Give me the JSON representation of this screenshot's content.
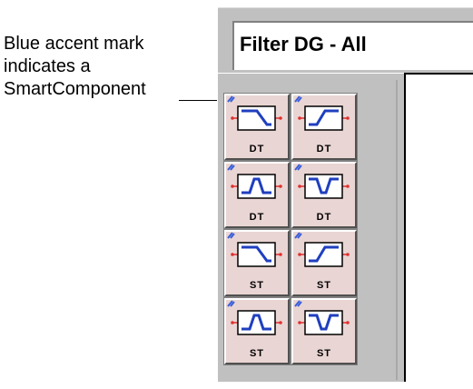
{
  "callout": {
    "lines": [
      "Blue accent mark",
      "indicates a",
      "SmartComponent"
    ]
  },
  "palette": {
    "filter_title": "Filter DG - All",
    "accent_color": "#3b5fd9",
    "pin_color": "#e03030",
    "components": [
      {
        "shape": "lowpass",
        "label": "DT",
        "icon": "lowpass-filter-icon"
      },
      {
        "shape": "highpass",
        "label": "DT",
        "icon": "highpass-filter-icon"
      },
      {
        "shape": "bandpass",
        "label": "DT",
        "icon": "bandpass-filter-icon"
      },
      {
        "shape": "bandstop",
        "label": "DT",
        "icon": "bandstop-filter-icon"
      },
      {
        "shape": "lowpass",
        "label": "ST",
        "icon": "lowpass-filter-icon"
      },
      {
        "shape": "highpass",
        "label": "ST",
        "icon": "highpass-filter-icon"
      },
      {
        "shape": "bandpass",
        "label": "ST",
        "icon": "bandpass-filter-icon"
      },
      {
        "shape": "bandstop",
        "label": "ST",
        "icon": "bandstop-filter-icon"
      }
    ]
  }
}
